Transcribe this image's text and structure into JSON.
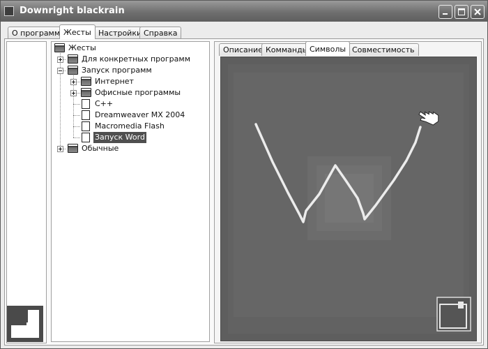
{
  "window": {
    "title": "Downright blackrain"
  },
  "main_tabs": [
    {
      "label": "О программе",
      "active": false
    },
    {
      "label": "Жесты",
      "active": true
    },
    {
      "label": "Настройки",
      "active": false
    },
    {
      "label": "Справка",
      "active": false
    }
  ],
  "tree": {
    "root": "Жесты",
    "items": {
      "for_programs": "Для конкретных программ",
      "launch": "Запуск программ",
      "internet": "Интернет",
      "office": "Офисные программы",
      "cpp": "C++",
      "dreamweaver": "Dreamweaver MX 2004",
      "flash": "Macromedia Flash",
      "word": "Запуск Word",
      "normal": "Обычные"
    },
    "selected": "Запуск Word"
  },
  "detail_tabs": [
    {
      "label": "Описание",
      "active": false
    },
    {
      "label": "Комманды",
      "active": false
    },
    {
      "label": "Символы",
      "active": true
    },
    {
      "label": "Совместимость",
      "active": false
    }
  ],
  "colors": {
    "canvas_bg": "#5e5e5e",
    "gesture_stroke": "#ececec",
    "selection": "#4f4f4f"
  },
  "icons": {
    "app": "app-icon",
    "minimize": "minimize-icon",
    "maximize": "maximize-icon",
    "close": "close-icon",
    "cursor": "hand-pointer-icon",
    "preview": "gesture-preview-icon"
  }
}
